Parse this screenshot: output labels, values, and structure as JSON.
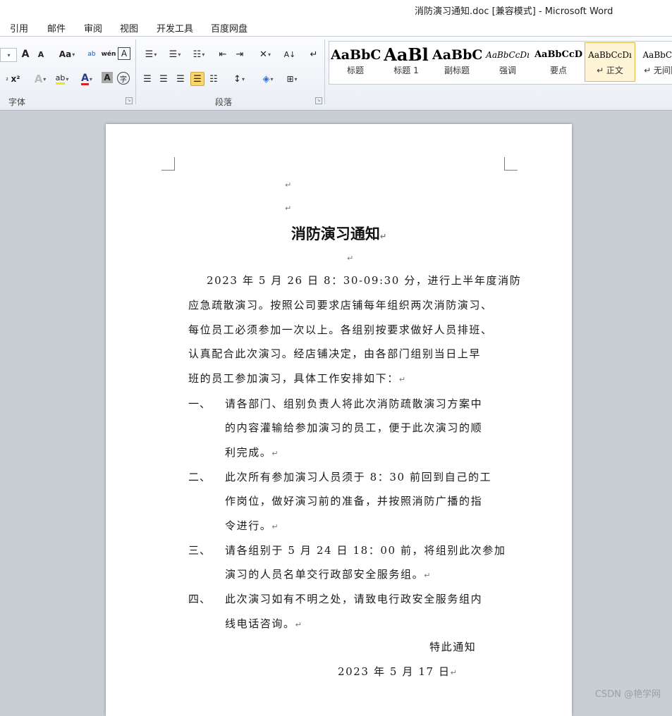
{
  "window": {
    "title": "消防演习通知.doc [兼容模式]  -  Microsoft Word"
  },
  "tabs": [
    "引用",
    "邮件",
    "审阅",
    "视图",
    "开发工具",
    "百度网盘"
  ],
  "ribbon": {
    "font_group_label": "字体",
    "paragraph_group_label": "段落",
    "styles": [
      {
        "sample": "AaBbC",
        "name": "标题"
      },
      {
        "sample": "AaBl",
        "name": "标题 1"
      },
      {
        "sample": "AaBbC",
        "name": "副标题"
      },
      {
        "sample": "AaBbCcDı",
        "name": "强调"
      },
      {
        "sample": "AaBbCcD",
        "name": "要点"
      },
      {
        "sample": "AaBbCcDı",
        "name": "↵ 正文"
      },
      {
        "sample": "AaBbCcI",
        "name": "↵ 无间隔"
      }
    ],
    "font_button_labels": {
      "grow": "A",
      "shrink": "A",
      "change_case": "Aa",
      "pinyin": "wén",
      "char_border": "A",
      "superscript": "x²",
      "text_effect": "A",
      "highlight": "ab",
      "font_color": "A",
      "char_shading": "A",
      "enclose": "字"
    }
  },
  "document": {
    "para_mark": "↵",
    "title": "消防演习通知",
    "body_lines": [
      "2023 年 5 月 26 日 8：30-09:30 分，进行上半年度消防",
      "应急疏散演习。按照公司要求店铺每年组织两次消防演习、",
      "每位员工必须参加一次以上。各组别按要求做好人员排班、",
      "认真配合此次演习。经店铺决定，由各部门组别当日上早",
      "班的员工参加演习，具体工作安排如下："
    ],
    "items": [
      {
        "num": "一、",
        "lines": [
          "请各部门、组别负责人将此次消防疏散演习方案中",
          "的内容灌输给参加演习的员工，便于此次演习的顺",
          "利完成。"
        ]
      },
      {
        "num": "二、",
        "lines": [
          "此次所有参加演习人员须于 8：30 前回到自己的工",
          "作岗位，做好演习前的准备，并按照消防广播的指",
          "令进行。"
        ]
      },
      {
        "num": "三、",
        "lines": [
          "请各组别于 5 月 24 日 18：00 前，将组别此次参加",
          "演习的人员名单交行政部安全服务组。"
        ]
      },
      {
        "num": "四、",
        "lines": [
          "此次演习如有不明之处，请致电行政安全服务组内",
          "线电话咨询。"
        ]
      }
    ],
    "closing": "特此通知",
    "date": "2023 年 5 月 17 日"
  },
  "watermark": "CSDN @艳学网"
}
